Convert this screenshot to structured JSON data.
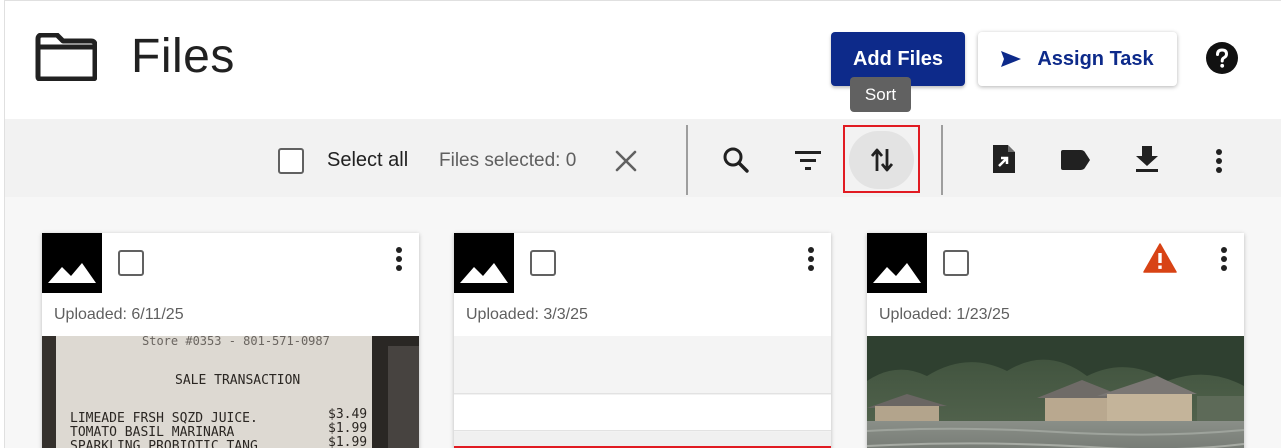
{
  "header": {
    "title": "Files",
    "add_files_label": "Add Files",
    "assign_task_label": "Assign Task",
    "sort_tooltip": "Sort"
  },
  "toolbar": {
    "select_all_label": "Select all",
    "files_selected_text": "Files selected: 0"
  },
  "cards": [
    {
      "uploaded": "Uploaded: 6/11/25",
      "receipt_lines": {
        "store": "Store #0353 - 801-571-0987",
        "transaction": "SALE TRANSACTION",
        "item1": "LIMEADE FRSH SQZD JUICE.",
        "price1": "$3.49",
        "item2": "TOMATO BASIL MARINARA",
        "price2": "$1.99",
        "item3": "SPARKLING PROBIOTIC TANG",
        "price3": "$1.99"
      }
    },
    {
      "uploaded": "Uploaded: 3/3/25"
    },
    {
      "uploaded": "Uploaded: 1/23/25",
      "warning": true
    }
  ],
  "colors": {
    "primary": "#0d2a8a",
    "highlight": "#e11b22",
    "warning": "#d84315",
    "tooltip": "#616161"
  }
}
